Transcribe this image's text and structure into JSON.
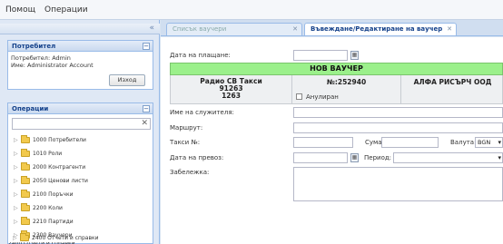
{
  "menu": {
    "help": "Помощ",
    "operations": "Операции"
  },
  "users_panel": {
    "title": "Потребител",
    "user_line": "Потребител: Admin",
    "name_line": "Име: Administrator Account",
    "logout_label": "Изход"
  },
  "operations_panel": {
    "title": "Операции",
    "items": [
      {
        "label": "1000 Потребители"
      },
      {
        "label": "1010 Роли"
      },
      {
        "label": "2000 Контрагенти"
      },
      {
        "label": "2050 Ценови листи"
      },
      {
        "label": "2100 Поръчки"
      },
      {
        "label": "2200 Коли"
      },
      {
        "label": "2210 Партиди"
      },
      {
        "label": "2300 Ваучери"
      },
      {
        "label": "2400 Отчети и справки"
      }
    ]
  },
  "tabs": [
    {
      "label": "Списък ваучери",
      "active": false
    },
    {
      "label": "Въвеждане/Редактиране на ваучер",
      "active": true
    }
  ],
  "form": {
    "payment_date_label": "Дата на плащане:",
    "new_voucher_title": "НОВ ВАУЧЕР",
    "company_name": "Радио СВ Такси",
    "company_num1": "91263",
    "company_num2": "1263",
    "voucher_number": "№:252940",
    "annul_label": "Анулиран",
    "client_name": "АЛФА РИСЪРЧ ООД",
    "employee_label": "Име на служителя:",
    "route_label": "Маршрут:",
    "taxi_label": "Такси №:",
    "sum_label": "Сума:",
    "currency_label": "Валута:",
    "currency_value": "BGN",
    "transfer_date_label": "Дата на превоз:",
    "period_label": "Период:",
    "note_label": "Забележка:"
  },
  "colors": {
    "accent": "#15428b",
    "green": "#9bf08b"
  }
}
